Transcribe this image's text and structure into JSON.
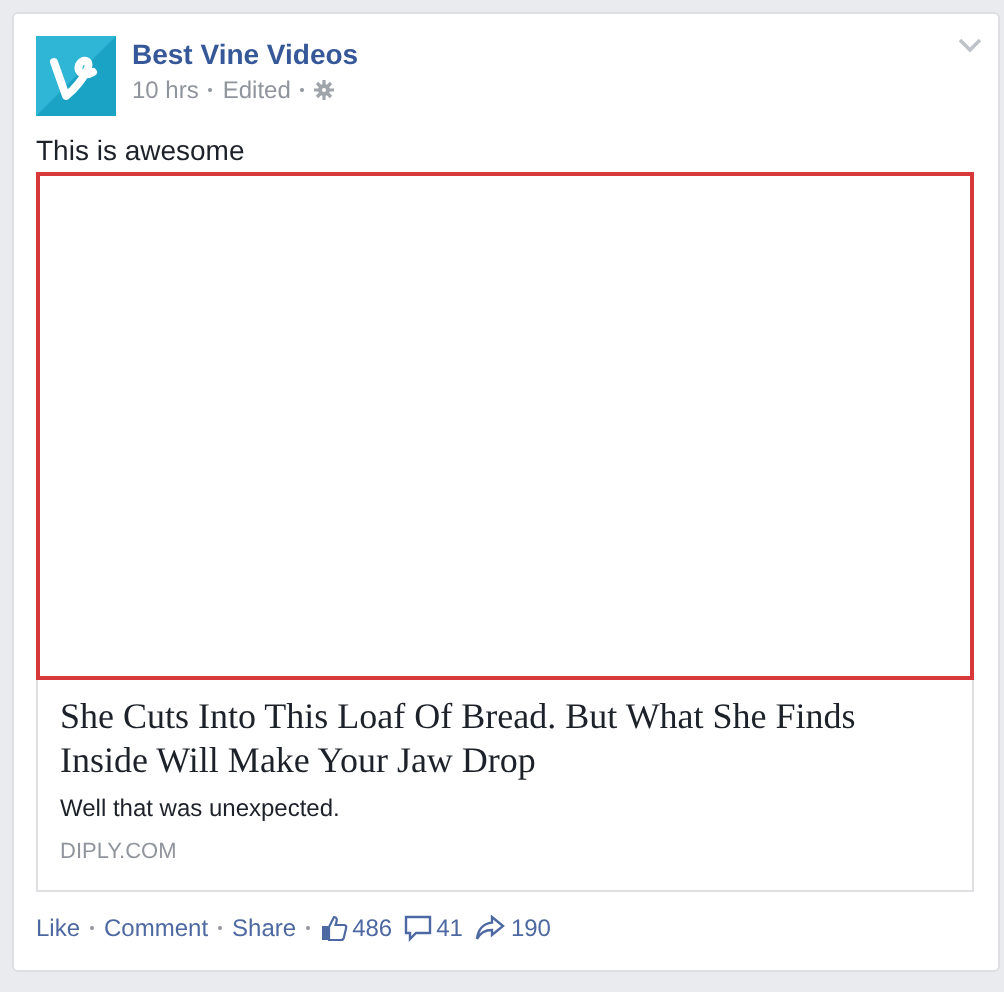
{
  "post": {
    "author": "Best Vine Videos",
    "time": "10 hrs",
    "edited": "Edited",
    "message": "This is awesome",
    "link": {
      "title": "She Cuts Into This Loaf Of Bread. But What She Finds Inside Will Make Your Jaw Drop",
      "description": "Well that was unexpected.",
      "domain": "DIPLY.COM"
    },
    "actions": [
      "Like",
      "Comment",
      "Share"
    ],
    "counts": [
      {
        "kind": "likes",
        "value": "486"
      },
      {
        "kind": "comments",
        "value": "41"
      },
      {
        "kind": "shares",
        "value": "190"
      }
    ]
  }
}
